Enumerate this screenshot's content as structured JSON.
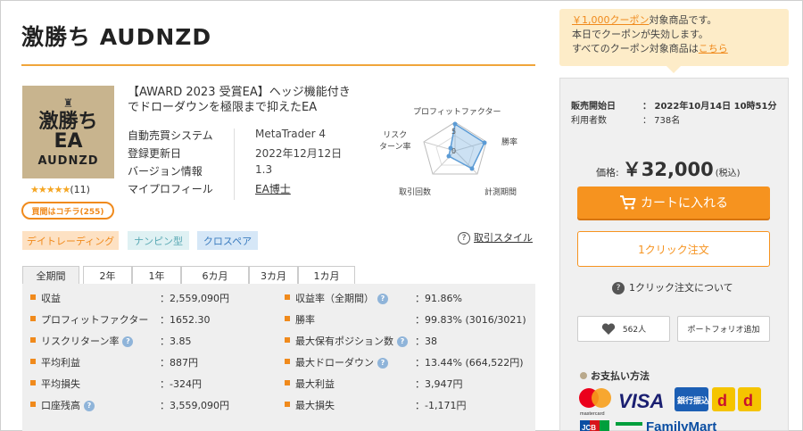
{
  "page": {
    "title": "激勝ち AUDNZD"
  },
  "product": {
    "thumb": {
      "line1": "激勝ち",
      "line2": "EA",
      "line3": "AUDNZD"
    },
    "rating_stars": "★★★★★",
    "rating_count": "(11)",
    "buy_here": "買間はコチラ(255)",
    "description": "【AWARD 2023 受賞EA】ヘッジ機能付きでドローダウンを極限まで抑えたEA",
    "info": [
      {
        "key": "自動売買システム",
        "value": "MetaTrader 4"
      },
      {
        "key": "登録更新日",
        "value": "2022年12月12日"
      },
      {
        "key": "バージョン情報",
        "value": "1.3"
      },
      {
        "key": "マイプロフィール",
        "value": "EA博士"
      }
    ]
  },
  "radar": {
    "labels": {
      "top": "プロフィットファクター",
      "left": "リスク\nターン率",
      "right": "勝率",
      "bottom_left": "取引回数",
      "bottom_right": "計測期間"
    },
    "tick_5": "5",
    "tick_0": "0"
  },
  "tags": [
    "デイトレーディング",
    "ナンピン型",
    "クロスペア"
  ],
  "tag_colors": {
    "orange_bg": "#fde1c3",
    "orange_fg": "#f08a1c",
    "teal_bg": "#dff1f3",
    "teal_fg": "#5aa9b4",
    "blue_bg": "#d6e7f7",
    "blue_fg": "#3a7bbf"
  },
  "torihiki_style": "取引スタイル",
  "period_tabs": [
    "全期間",
    "2年",
    "1年",
    "6カ月",
    "3カ月",
    "1カ月"
  ],
  "stats": {
    "left": [
      {
        "key": "収益",
        "value": "：2,559,090円",
        "help": false
      },
      {
        "key": "プロフィットファクター",
        "value": "：1652.30",
        "help": false
      },
      {
        "key": "リスクリターン率",
        "value": "：3.85",
        "help": true
      },
      {
        "key": "平均利益",
        "value": "：887円",
        "help": false
      },
      {
        "key": "平均損失",
        "value": "：-324円",
        "help": false
      },
      {
        "key": "口座残高",
        "value": "：3,559,090円",
        "help": true
      }
    ],
    "right": [
      {
        "key": "収益率（全期間）",
        "value": "：91.86%",
        "help": true
      },
      {
        "key": "勝率",
        "value": "：99.83% (3016/3021)",
        "help": false
      },
      {
        "key": "最大保有ポジション数",
        "value": "：38",
        "help": true
      },
      {
        "key": "最大ドローダウン",
        "value": "：13.44% (664,522円)",
        "help": true
      },
      {
        "key": "最大利益",
        "value": "：3,947円",
        "help": false
      },
      {
        "key": "最大損失",
        "value": "：-1,171円",
        "help": false
      }
    ]
  },
  "coupon": {
    "line1_hl": "￥1,000クーポン",
    "line1_rest": "対象商品です。",
    "line2": "本日でクーポンが失効します。",
    "line3_pre": "すべてのクーポン対象商品は",
    "line3_link": "こちら"
  },
  "sidebar": {
    "sale_start_label": "販売開始日",
    "sale_start_value": "：  2022年10月14日 10時51分",
    "users_label": "利用者数",
    "users_value": "：  738名",
    "price_label": "価格:",
    "price_value": "￥32,000",
    "price_tax": "(税込)",
    "cart_label": "カートに入れる",
    "one_click_label": "1クリック注文",
    "about_one_click": "1クリック注文について",
    "favorites": "562人",
    "portfolio_add": "ポートフォリオ追加",
    "payment_title": "お支払い方法",
    "pay_logos": {
      "mastercard": "mastercard",
      "visa": "VISA",
      "bank": "銀行振込",
      "d1": "d",
      "d2": "d",
      "jcb": "JCB",
      "familymart": "FamilyMart"
    }
  },
  "colors": {
    "accent": "#f6931f",
    "stats_bg": "#efefef",
    "coupon_bg": "#fdecc8"
  }
}
